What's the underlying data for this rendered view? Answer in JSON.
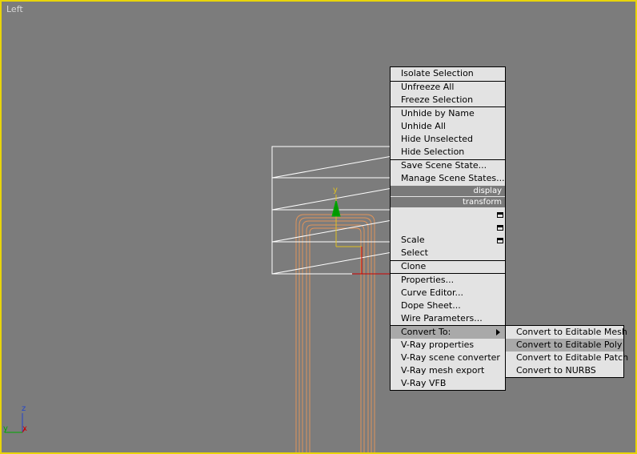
{
  "viewport": {
    "label": "Left"
  },
  "gizmo": {
    "y_axis_label": "y"
  },
  "axis_tripod": {
    "z": "z",
    "y": "y",
    "x": "x"
  },
  "quad_menu": {
    "items_top": [
      "Isolate Selection",
      "Unfreeze All",
      "Freeze Selection",
      "Unhide by Name",
      "Unhide All",
      "Hide Unselected",
      "Hide Selection",
      "Save Scene State...",
      "Manage Scene States..."
    ],
    "display_header": "display",
    "transform_header": "transform",
    "transform_items": [
      "Scale",
      "Select",
      "Clone",
      "Properties...",
      "Curve Editor...",
      "Dope Sheet...",
      "Wire Parameters..."
    ],
    "convert_to": "Convert To:",
    "vray_items": [
      "V-Ray properties",
      "V-Ray scene converter",
      "V-Ray mesh export",
      "V-Ray VFB"
    ]
  },
  "submenu": {
    "items": [
      "Convert to Editable Mesh",
      "Convert to Editable Poly",
      "Convert to Editable Patch",
      "Convert to NURBS"
    ],
    "highlighted_index": 1
  },
  "colors": {
    "viewport_border": "#e8d40a",
    "background": "#7c7c7c",
    "object_wire": "#e0945a",
    "menu_bg": "#e3e3e3",
    "highlight": "#a9a9a9"
  }
}
